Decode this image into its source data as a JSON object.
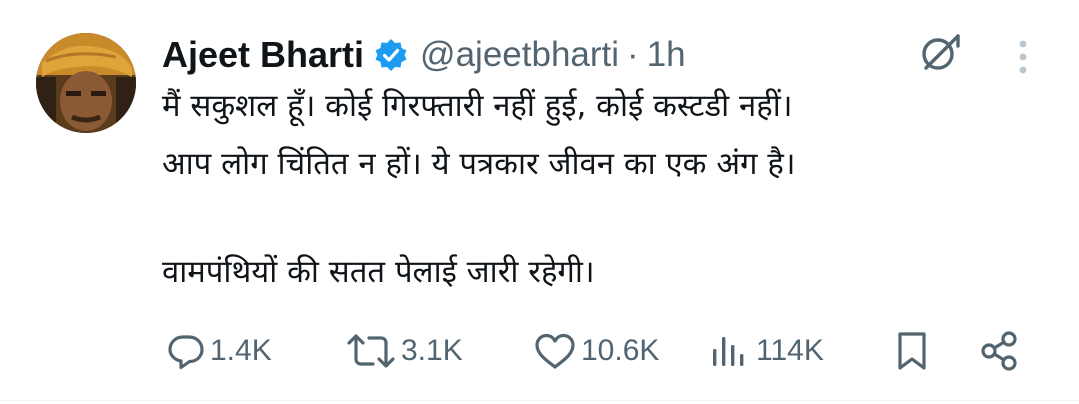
{
  "tweet": {
    "author_name": "Ajeet Bharti",
    "handle": "@ajeetbharti",
    "separator": "·",
    "time": "1h",
    "lines": [
      "मैं सकुशल हूँ। कोई गिरफ्तारी नहीं हुई, कोई कस्टडी नहीं।",
      "आप लोग चिंतित न हों। ये पत्रकार जीवन का एक अंग है।",
      "वामपंथियों की सतत पेलाई जारी रहेगी।"
    ]
  },
  "actions": {
    "replies": "1.4K",
    "reposts": "3.1K",
    "likes": "10.6K",
    "views": "114K"
  },
  "colors": {
    "text": "#0f1419",
    "secondary": "#536471",
    "verified": "#1d9bf0",
    "muted_icon": "#b9c5cf"
  },
  "icons": [
    "verified-badge-icon",
    "grok-icon",
    "more-options-icon",
    "reply-icon",
    "repost-icon",
    "like-icon",
    "views-icon",
    "bookmark-icon",
    "share-icon"
  ]
}
